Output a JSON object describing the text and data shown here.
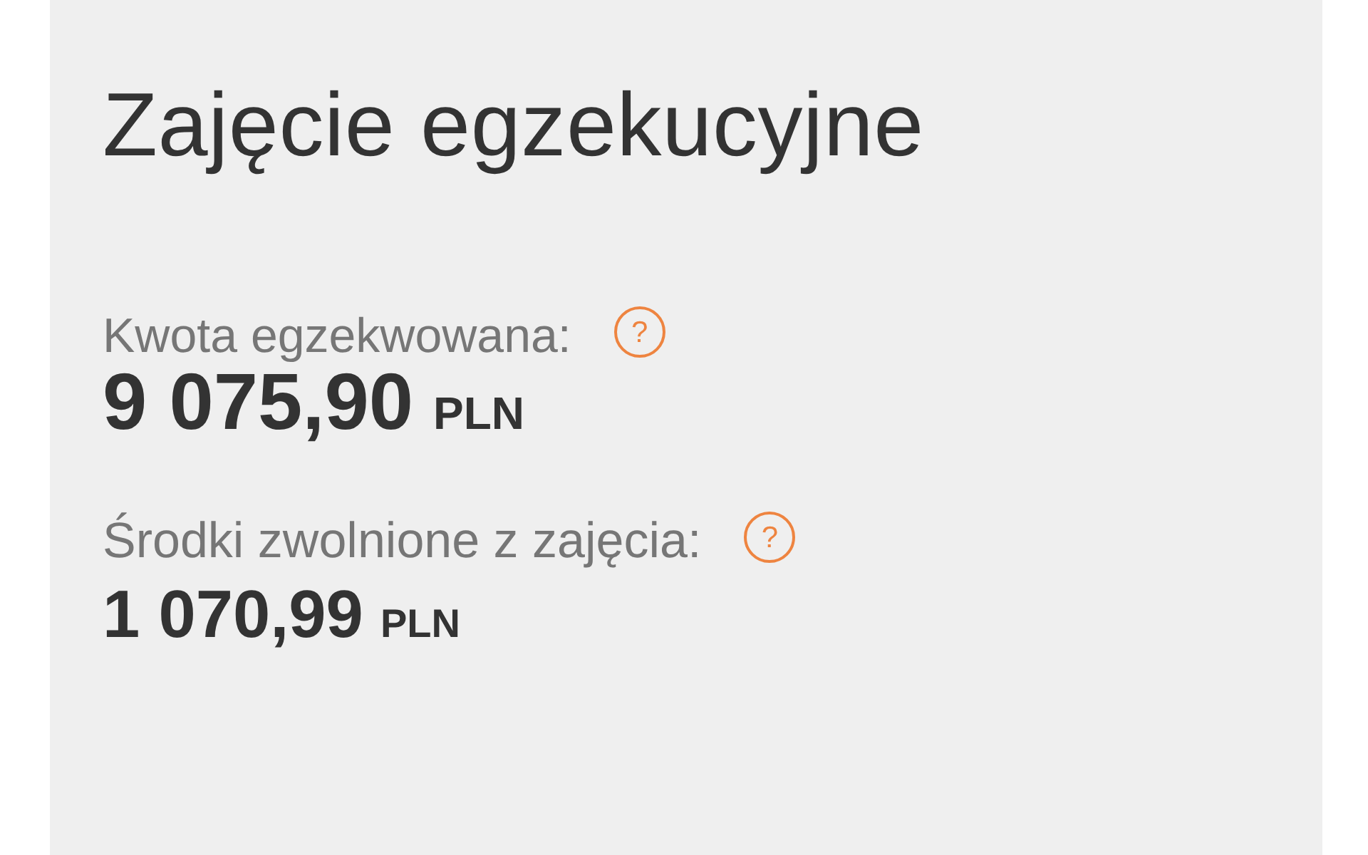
{
  "title": "Zajęcie egzekucyjne",
  "fields": [
    {
      "kind": "primary",
      "label": "Kwota egzekwowana:",
      "help": "?",
      "amount": "9 075,90",
      "currency": "PLN"
    },
    {
      "kind": "secondary",
      "label": "Środki zwolnione z zajęcia:",
      "help": "?",
      "amount": "1 070,99",
      "currency": "PLN"
    }
  ]
}
